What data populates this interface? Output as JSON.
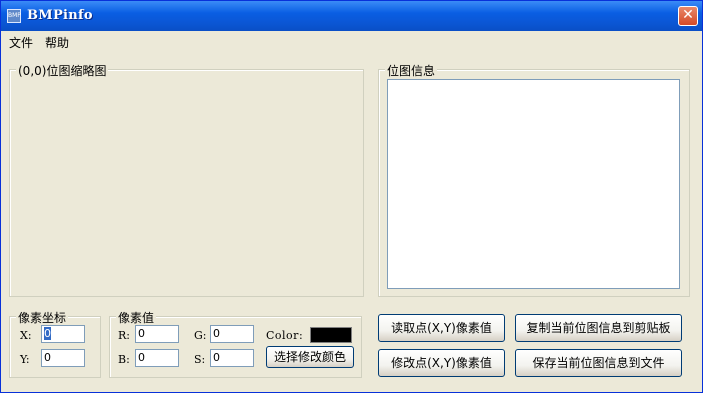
{
  "window": {
    "title": "BMPinfo",
    "icon": "bitmap-app-icon",
    "close_glyph": "✕"
  },
  "menu": {
    "items": [
      "文件",
      "帮助"
    ]
  },
  "thumbnail_group": {
    "legend": "(0,0)位图缩略图"
  },
  "info_group": {
    "legend": "位图信息",
    "text": ""
  },
  "pixel_coord_group": {
    "legend": "像素坐标",
    "x_label": "X:",
    "x_value": "0",
    "y_label": "Y:",
    "y_value": "0"
  },
  "pixel_value_group": {
    "legend": "像素值",
    "r_label": "R:",
    "r_value": "0",
    "g_label": "G:",
    "g_value": "0",
    "b_label": "B:",
    "b_value": "0",
    "s_label": "S:",
    "s_value": "0",
    "color_label": "Color:",
    "color_value": "#000000",
    "choose_color_button": "选择修改颜色"
  },
  "buttons": {
    "read_pixel": "读取点(X,Y)像素值",
    "modify_pixel": "修改点(X,Y)像素值",
    "copy_info": "复制当前位图信息到剪贴板",
    "save_info": "保存当前位图信息到文件"
  },
  "colors": {
    "window_bg": "#ece9d8",
    "titlebar": "#0a5ee3",
    "close": "#d44a27",
    "selection": "#316ac5"
  }
}
